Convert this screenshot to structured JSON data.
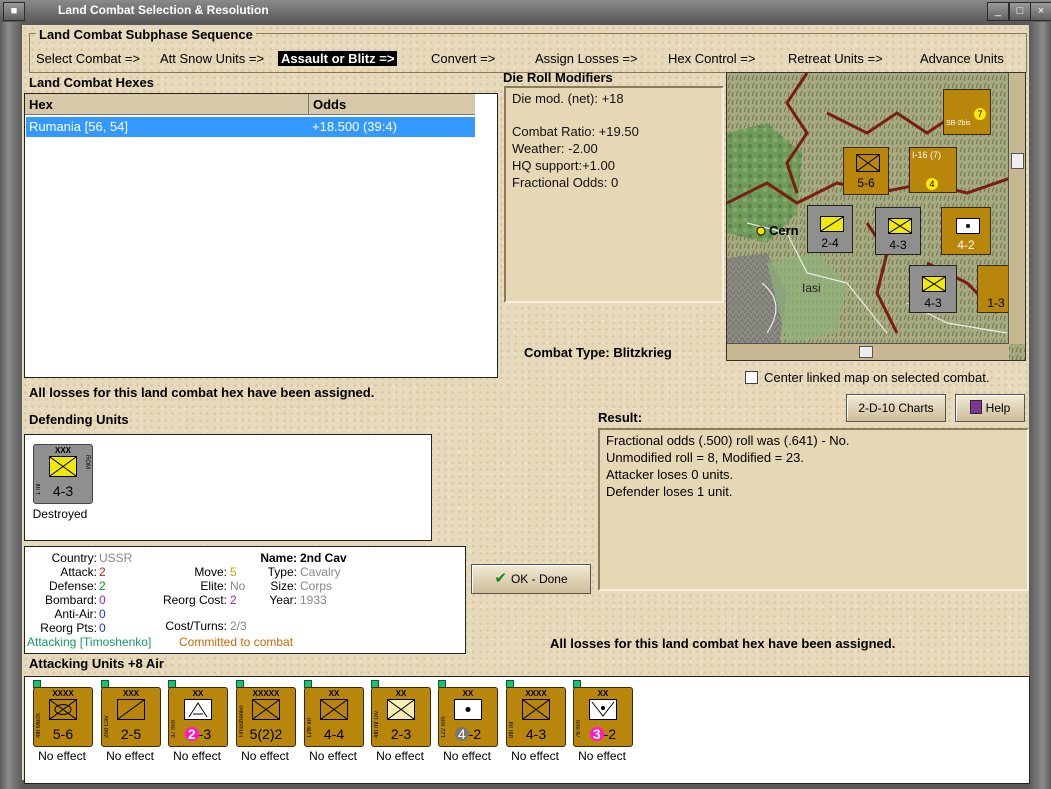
{
  "window": {
    "title": "Land Combat Selection & Resolution"
  },
  "subphase": {
    "title": "Land Combat Subphase Sequence",
    "steps": [
      {
        "label": "Select Combat =>",
        "active": false
      },
      {
        "label": "Att Snow Units =>",
        "active": false
      },
      {
        "label": "Assault or Blitz =>",
        "active": true
      },
      {
        "label": "Convert =>",
        "active": false
      },
      {
        "label": "Assign Losses =>",
        "active": false
      },
      {
        "label": "Hex Control =>",
        "active": false
      },
      {
        "label": "Retreat Units =>",
        "active": false
      },
      {
        "label": "Advance Units",
        "active": false
      }
    ]
  },
  "hexes": {
    "title": "Land Combat Hexes",
    "columns": [
      "Hex",
      "Odds"
    ],
    "rows": [
      {
        "hex": "Rumania [56, 54]",
        "odds": "+18.500 (39:4)"
      }
    ]
  },
  "die_roll": {
    "title": "Die Roll Modifiers",
    "lines": [
      "Die mod. (net): +18",
      "",
      "Combat Ratio: +19.50",
      "Weather: -2.00",
      "HQ support:+1.00",
      "Fractional Odds: 0"
    ]
  },
  "combat_type": {
    "label": "Combat Type:",
    "value": "Blitzkrieg"
  },
  "center_map": {
    "label": "Center linked map on selected combat.",
    "checked": false
  },
  "losses_note_top": "All losses for this land combat hex have been assigned.",
  "losses_note_bottom": "All losses for this land combat hex have been assigned.",
  "buttons": {
    "charts": "2-D-10 Charts",
    "help": "Help",
    "ok": "OK - Done"
  },
  "defending": {
    "title": "Defending Units",
    "units": [
      {
        "size": "XXX",
        "name": "1 Inf",
        "nation": "ROM",
        "strength": "4-3",
        "type": "infantry",
        "color": "#8f8f8f",
        "status": "Destroyed"
      }
    ]
  },
  "unit_info": {
    "country_label": "Country:",
    "country": "USSR",
    "attack_label": "Attack:",
    "attack": "2",
    "defense_label": "Defense:",
    "defense": "2",
    "bombard_label": "Bombard:",
    "bombard": "0",
    "antiair_label": "Anti-Air:",
    "antiair": "0",
    "reorg_label": "Reorg Pts:",
    "reorg": "0",
    "move_label": "Move:",
    "move": "5",
    "elite_label": "Elite:",
    "elite": "No",
    "reorgcost_label": "Reorg Cost:",
    "reorgcost": "2",
    "costturns_label": "Cost/Turns:",
    "costturns": "2/3",
    "name_label": "Name:",
    "name": "2nd Cav",
    "type_label": "Type:",
    "type": "Cavalry",
    "size_label": "Size:",
    "size": "Corps",
    "year_label": "Year:",
    "year": "1933",
    "attacking": "Attacking [Timoshenko]",
    "committed": "Committed to combat"
  },
  "result": {
    "title": "Result:",
    "lines": [
      "Fractional odds (.500) roll was (.641)  - No.",
      "Unmodified roll = 8, Modified = 23.",
      "Attacker loses 0 units.",
      "Defender loses 1 unit."
    ]
  },
  "attacking": {
    "title": "Attacking Units +8 Air",
    "units": [
      {
        "size": "XXXX",
        "name": "4th Mech",
        "strength": "5-6",
        "type": "mech",
        "status": "No effect"
      },
      {
        "size": "XXX",
        "name": "2nd Cav",
        "strength": "2-5",
        "type": "cav",
        "status": "No effect"
      },
      {
        "size": "XX",
        "name": "37 mm",
        "strength_a": "2",
        "strength_b": "-3",
        "type": "aa",
        "status": "No effect"
      },
      {
        "size": "XXXXX",
        "name": "Timoshenko",
        "strength": "5(2)2",
        "type": "hq",
        "status": "No effect"
      },
      {
        "size": "XX",
        "name": "12th Inf",
        "strength": "4-4",
        "type": "inf",
        "status": "No effect"
      },
      {
        "size": "XX",
        "name": "4th Inf Div",
        "strength": "2-3",
        "type": "inf-lt",
        "status": "No effect"
      },
      {
        "size": "XX",
        "name": "122 mm",
        "strength_a": "4",
        "strength_b": "-2",
        "type": "art",
        "status": "No effect"
      },
      {
        "size": "XXXX",
        "name": "8th Inf",
        "strength": "4-3",
        "type": "inf",
        "status": "No effect"
      },
      {
        "size": "XX",
        "name": "76 mm",
        "strength_a": "3",
        "strength_b": "-2",
        "type": "at",
        "status": "No effect"
      }
    ]
  },
  "map": {
    "labels": [
      "Cern",
      "Iasi"
    ],
    "counters": [
      {
        "top": "3",
        "strength": "5-6",
        "size": "XXXX"
      },
      {
        "top": "4",
        "strength": "I-16 (7)",
        "badge": "4"
      },
      {
        "top": "",
        "strength": "2-4",
        "size": "XXX"
      },
      {
        "top": "",
        "strength": "4-3",
        "size": "XXX"
      },
      {
        "top": "",
        "strength": "4-2",
        "size": "XX"
      },
      {
        "top": "",
        "strength": "4-3",
        "size": "XXX"
      },
      {
        "top": "3",
        "strength": "SB-2bis",
        "badge": "7"
      },
      {
        "top": "",
        "strength": "1-3"
      }
    ]
  }
}
